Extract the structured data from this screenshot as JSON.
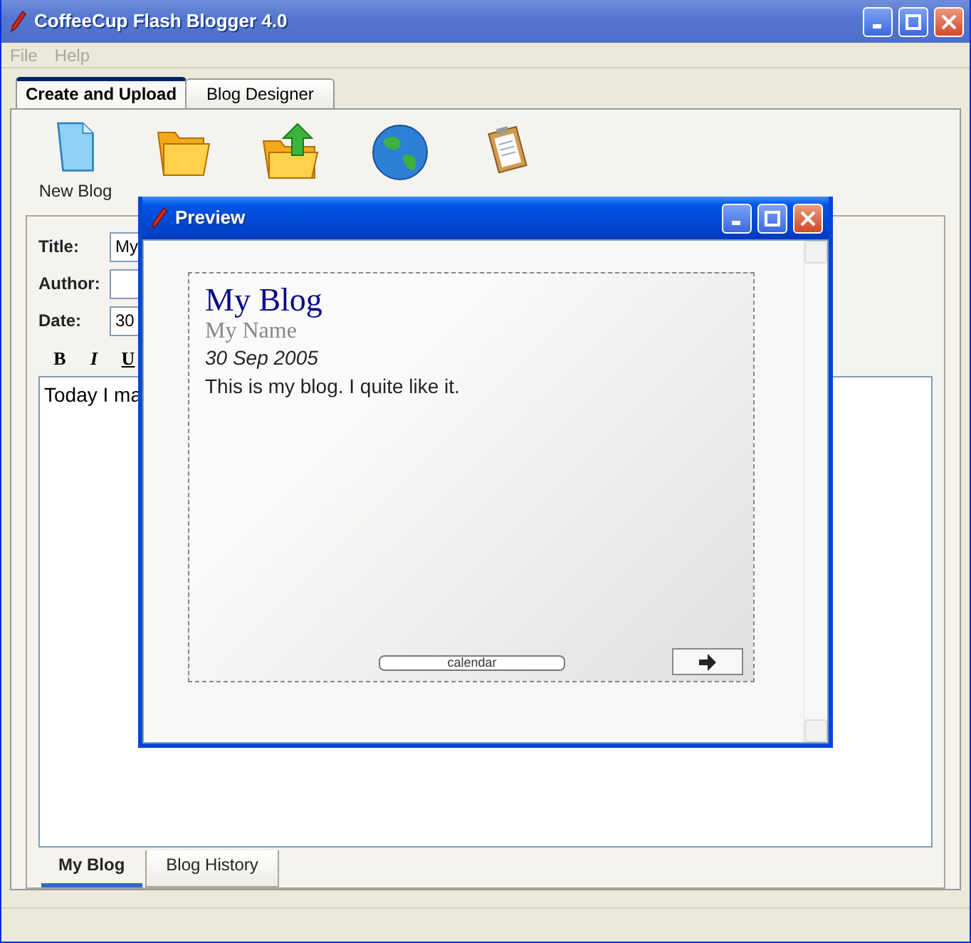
{
  "window": {
    "title": "CoffeeCup Flash Blogger 4.0"
  },
  "menu": [
    "File",
    "Help"
  ],
  "tabs": [
    {
      "label": "Create and Upload",
      "selected": true
    },
    {
      "label": "Blog Designer",
      "selected": false
    }
  ],
  "toolbar": [
    {
      "kind": "new",
      "label": "New Blog"
    },
    {
      "kind": "open"
    },
    {
      "kind": "upload"
    },
    {
      "kind": "globe"
    },
    {
      "kind": "clipboard"
    }
  ],
  "form": {
    "fields": [
      {
        "label": "Title:",
        "value": "My"
      },
      {
        "label": "Author:"
      },
      {
        "label": "Date:",
        "value": "30"
      }
    ],
    "format_buttons": [
      "B",
      "I",
      "U"
    ],
    "body": "Today I ma"
  },
  "bottom_tabs": [
    {
      "label": "My Blog",
      "selected": true
    },
    {
      "label": "Blog History",
      "selected": false
    }
  ],
  "preview": {
    "title": "Preview",
    "blog_title": "My Blog",
    "author": "My Name",
    "date": "30 Sep 2005",
    "text": "This is my blog. I quite like it.",
    "calendar_label": "calendar"
  }
}
